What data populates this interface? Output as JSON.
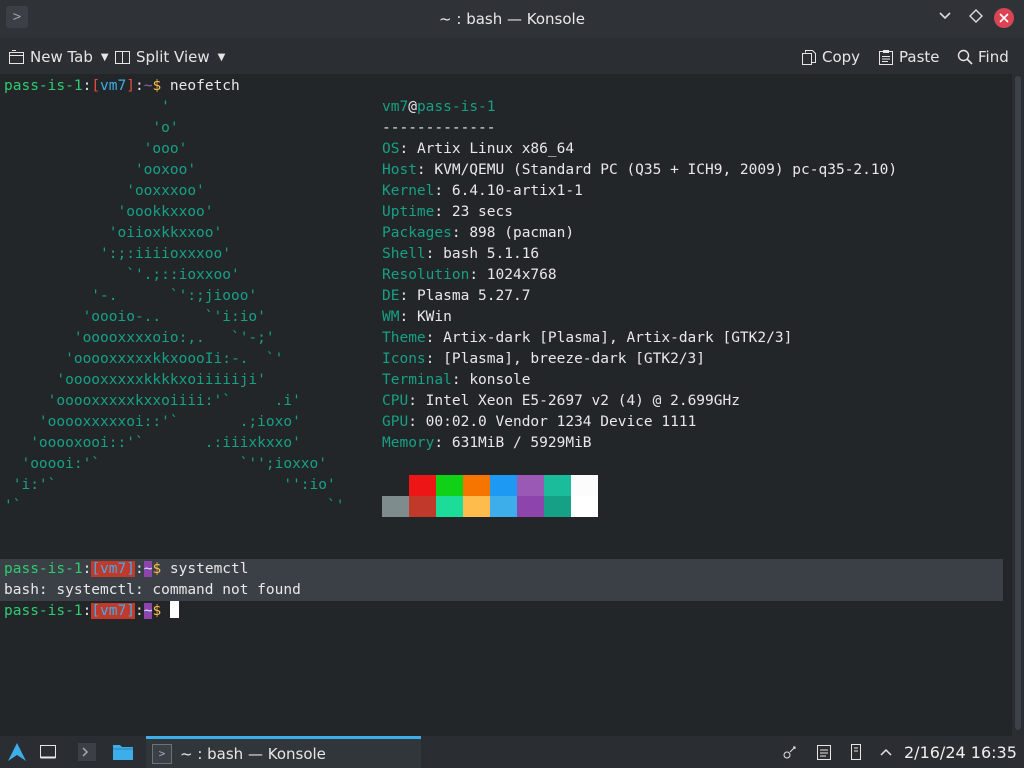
{
  "window": {
    "title": "~ : bash — Konsole"
  },
  "toolbar": {
    "new_tab": "New Tab",
    "split_view": "Split View",
    "copy": "Copy",
    "paste": "Paste",
    "find": "Find"
  },
  "terminal": {
    "prompt": {
      "host": "pass-is-1",
      "user": "vm7",
      "dir": "~",
      "symbol": "$"
    },
    "command1": "neofetch",
    "art": [
      "                  '",
      "                 'o'",
      "                'ooo'",
      "               'ooxoo'",
      "              'ooxxxoo'",
      "             'oookkxxoo'",
      "            'oiioxkkxxoo'",
      "           ':;:iiiioxxxoo'",
      "              `'.;::ioxxoo'",
      "          '-.      `':;jiooo'",
      "         'oooio-..     `'i:io'",
      "        'ooooxxxxoio:,.   `'-;'",
      "       'ooooxxxxxkkxoooIi:-.  `'",
      "      'ooooxxxxxkkkkxoiiiiiji'",
      "     'ooooxxxxxkxxoiiii:'`     .i'",
      "    'ooooxxxxxoi::'`       .;ioxo'",
      "   'ooooxooi::'`       .:iiixkxxo'",
      "  'ooooi:'`                `'';ioxxo'",
      " 'i:'`                          '':io'",
      "'`                                   `'"
    ],
    "info_header_user": "vm7",
    "info_header_at": "@",
    "info_header_host": "pass-is-1",
    "info_separator": "-------------",
    "info": [
      {
        "key": "OS",
        "value": "Artix Linux x86_64"
      },
      {
        "key": "Host",
        "value": "KVM/QEMU (Standard PC (Q35 + ICH9, 2009) pc-q35-2.10)"
      },
      {
        "key": "Kernel",
        "value": "6.4.10-artix1-1"
      },
      {
        "key": "Uptime",
        "value": "23 secs"
      },
      {
        "key": "Packages",
        "value": "898 (pacman)"
      },
      {
        "key": "Shell",
        "value": "bash 5.1.16"
      },
      {
        "key": "Resolution",
        "value": "1024x768"
      },
      {
        "key": "DE",
        "value": "Plasma 5.27.7"
      },
      {
        "key": "WM",
        "value": "KWin"
      },
      {
        "key": "Theme",
        "value": "Artix-dark [Plasma], Artix-dark [GTK2/3]"
      },
      {
        "key": "Icons",
        "value": "[Plasma], breeze-dark [GTK2/3]"
      },
      {
        "key": "Terminal",
        "value": "konsole"
      },
      {
        "key": "CPU",
        "value": "Intel Xeon E5-2697 v2 (4) @ 2.699GHz"
      },
      {
        "key": "GPU",
        "value": "00:02.0 Vendor 1234 Device 1111"
      },
      {
        "key": "Memory",
        "value": "631MiB / 5929MiB"
      }
    ],
    "palette_top": [
      "#232629",
      "#ed1515",
      "#11d116",
      "#f67400",
      "#1d99f3",
      "#9b59b6",
      "#1abc9c",
      "#fcfcfc"
    ],
    "palette_bottom": [
      "#7f8c8d",
      "#c0392b",
      "#1cdc9a",
      "#fdbc4b",
      "#3daee9",
      "#8e44ad",
      "#16a085",
      "#ffffff"
    ],
    "command2": "systemctl",
    "error": "bash: systemctl: command not found"
  },
  "taskbar": {
    "active_task": "~ : bash — Konsole",
    "clock": "2/16/24 16:35"
  },
  "colors": {
    "accent": "#3daee9",
    "close": "#da4453",
    "background": "#232629"
  }
}
